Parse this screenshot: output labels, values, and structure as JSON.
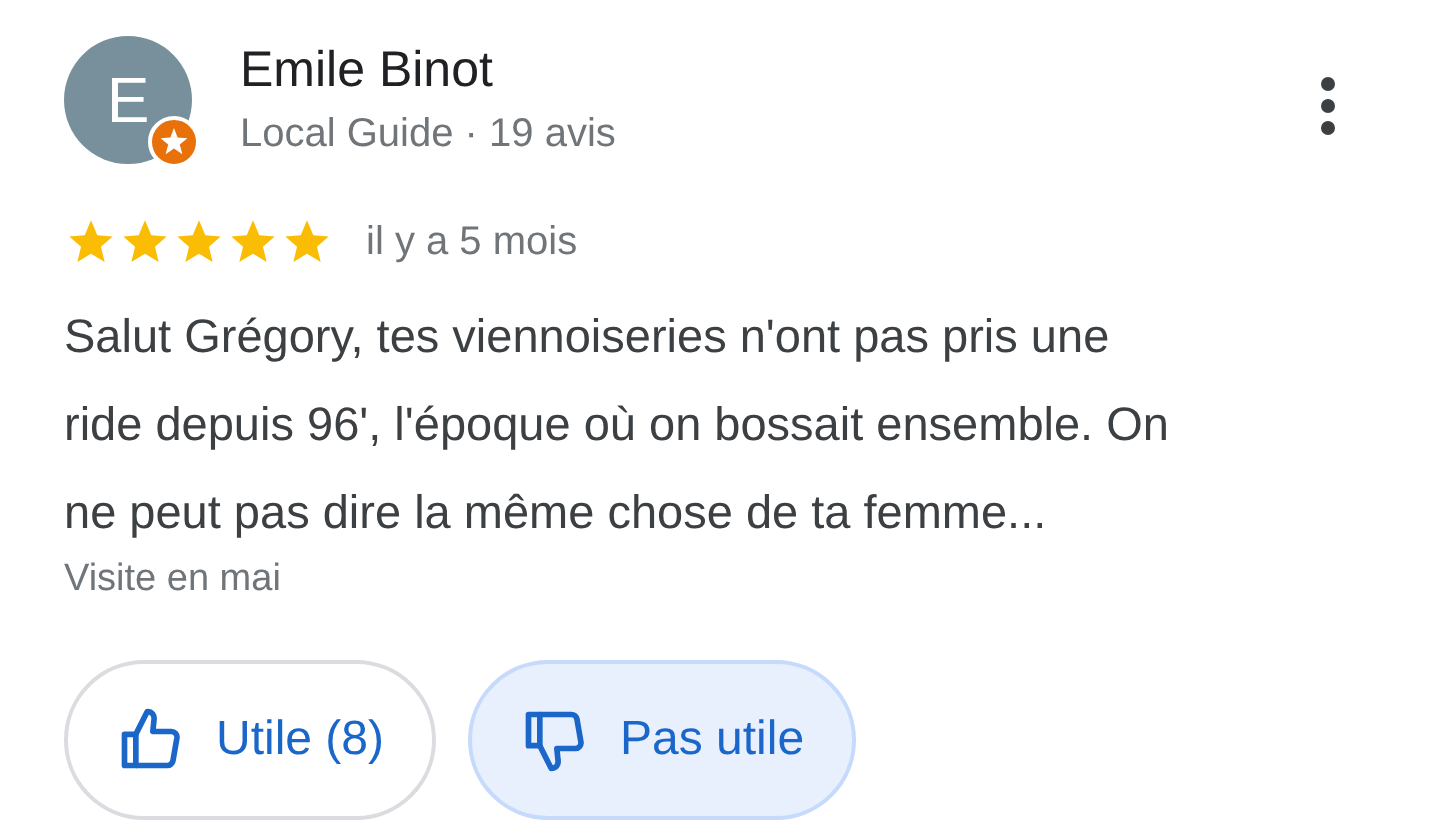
{
  "review": {
    "avatar_letter": "E",
    "local_guide_badge": true,
    "author": "Emile Binot",
    "subtitle": "Local Guide · 19 avis",
    "stars": 5,
    "time": "il y a 5 mois",
    "text_lines": [
      "Salut Grégory, tes viennoiseries n'ont pas pris une",
      "ride depuis 96', l'époque où on bossait ensemble. On",
      "ne peut pas dire la même chose de ta femme..."
    ],
    "visit": "Visite en mai"
  },
  "buttons": [
    {
      "kind": "like",
      "label": "Utile (8)",
      "selected": false
    },
    {
      "kind": "dislike",
      "label": "Pas utile",
      "selected": true
    }
  ]
}
